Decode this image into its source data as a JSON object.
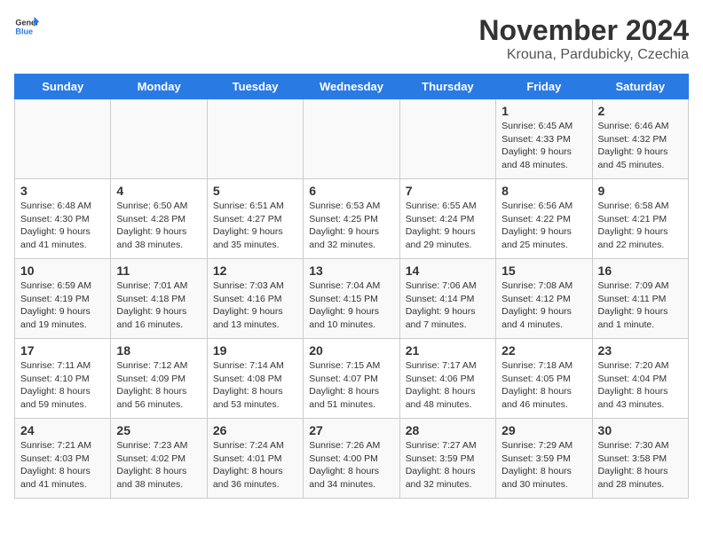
{
  "logo": {
    "line1": "General",
    "line2": "Blue"
  },
  "title": "November 2024",
  "location": "Krouna, Pardubicky, Czechia",
  "days_of_week": [
    "Sunday",
    "Monday",
    "Tuesday",
    "Wednesday",
    "Thursday",
    "Friday",
    "Saturday"
  ],
  "weeks": [
    [
      {
        "day": "",
        "info": ""
      },
      {
        "day": "",
        "info": ""
      },
      {
        "day": "",
        "info": ""
      },
      {
        "day": "",
        "info": ""
      },
      {
        "day": "",
        "info": ""
      },
      {
        "day": "1",
        "info": "Sunrise: 6:45 AM\nSunset: 4:33 PM\nDaylight: 9 hours\nand 48 minutes."
      },
      {
        "day": "2",
        "info": "Sunrise: 6:46 AM\nSunset: 4:32 PM\nDaylight: 9 hours\nand 45 minutes."
      }
    ],
    [
      {
        "day": "3",
        "info": "Sunrise: 6:48 AM\nSunset: 4:30 PM\nDaylight: 9 hours\nand 41 minutes."
      },
      {
        "day": "4",
        "info": "Sunrise: 6:50 AM\nSunset: 4:28 PM\nDaylight: 9 hours\nand 38 minutes."
      },
      {
        "day": "5",
        "info": "Sunrise: 6:51 AM\nSunset: 4:27 PM\nDaylight: 9 hours\nand 35 minutes."
      },
      {
        "day": "6",
        "info": "Sunrise: 6:53 AM\nSunset: 4:25 PM\nDaylight: 9 hours\nand 32 minutes."
      },
      {
        "day": "7",
        "info": "Sunrise: 6:55 AM\nSunset: 4:24 PM\nDaylight: 9 hours\nand 29 minutes."
      },
      {
        "day": "8",
        "info": "Sunrise: 6:56 AM\nSunset: 4:22 PM\nDaylight: 9 hours\nand 25 minutes."
      },
      {
        "day": "9",
        "info": "Sunrise: 6:58 AM\nSunset: 4:21 PM\nDaylight: 9 hours\nand 22 minutes."
      }
    ],
    [
      {
        "day": "10",
        "info": "Sunrise: 6:59 AM\nSunset: 4:19 PM\nDaylight: 9 hours\nand 19 minutes."
      },
      {
        "day": "11",
        "info": "Sunrise: 7:01 AM\nSunset: 4:18 PM\nDaylight: 9 hours\nand 16 minutes."
      },
      {
        "day": "12",
        "info": "Sunrise: 7:03 AM\nSunset: 4:16 PM\nDaylight: 9 hours\nand 13 minutes."
      },
      {
        "day": "13",
        "info": "Sunrise: 7:04 AM\nSunset: 4:15 PM\nDaylight: 9 hours\nand 10 minutes."
      },
      {
        "day": "14",
        "info": "Sunrise: 7:06 AM\nSunset: 4:14 PM\nDaylight: 9 hours\nand 7 minutes."
      },
      {
        "day": "15",
        "info": "Sunrise: 7:08 AM\nSunset: 4:12 PM\nDaylight: 9 hours\nand 4 minutes."
      },
      {
        "day": "16",
        "info": "Sunrise: 7:09 AM\nSunset: 4:11 PM\nDaylight: 9 hours\nand 1 minute."
      }
    ],
    [
      {
        "day": "17",
        "info": "Sunrise: 7:11 AM\nSunset: 4:10 PM\nDaylight: 8 hours\nand 59 minutes."
      },
      {
        "day": "18",
        "info": "Sunrise: 7:12 AM\nSunset: 4:09 PM\nDaylight: 8 hours\nand 56 minutes."
      },
      {
        "day": "19",
        "info": "Sunrise: 7:14 AM\nSunset: 4:08 PM\nDaylight: 8 hours\nand 53 minutes."
      },
      {
        "day": "20",
        "info": "Sunrise: 7:15 AM\nSunset: 4:07 PM\nDaylight: 8 hours\nand 51 minutes."
      },
      {
        "day": "21",
        "info": "Sunrise: 7:17 AM\nSunset: 4:06 PM\nDaylight: 8 hours\nand 48 minutes."
      },
      {
        "day": "22",
        "info": "Sunrise: 7:18 AM\nSunset: 4:05 PM\nDaylight: 8 hours\nand 46 minutes."
      },
      {
        "day": "23",
        "info": "Sunrise: 7:20 AM\nSunset: 4:04 PM\nDaylight: 8 hours\nand 43 minutes."
      }
    ],
    [
      {
        "day": "24",
        "info": "Sunrise: 7:21 AM\nSunset: 4:03 PM\nDaylight: 8 hours\nand 41 minutes."
      },
      {
        "day": "25",
        "info": "Sunrise: 7:23 AM\nSunset: 4:02 PM\nDaylight: 8 hours\nand 38 minutes."
      },
      {
        "day": "26",
        "info": "Sunrise: 7:24 AM\nSunset: 4:01 PM\nDaylight: 8 hours\nand 36 minutes."
      },
      {
        "day": "27",
        "info": "Sunrise: 7:26 AM\nSunset: 4:00 PM\nDaylight: 8 hours\nand 34 minutes."
      },
      {
        "day": "28",
        "info": "Sunrise: 7:27 AM\nSunset: 3:59 PM\nDaylight: 8 hours\nand 32 minutes."
      },
      {
        "day": "29",
        "info": "Sunrise: 7:29 AM\nSunset: 3:59 PM\nDaylight: 8 hours\nand 30 minutes."
      },
      {
        "day": "30",
        "info": "Sunrise: 7:30 AM\nSunset: 3:58 PM\nDaylight: 8 hours\nand 28 minutes."
      }
    ]
  ]
}
